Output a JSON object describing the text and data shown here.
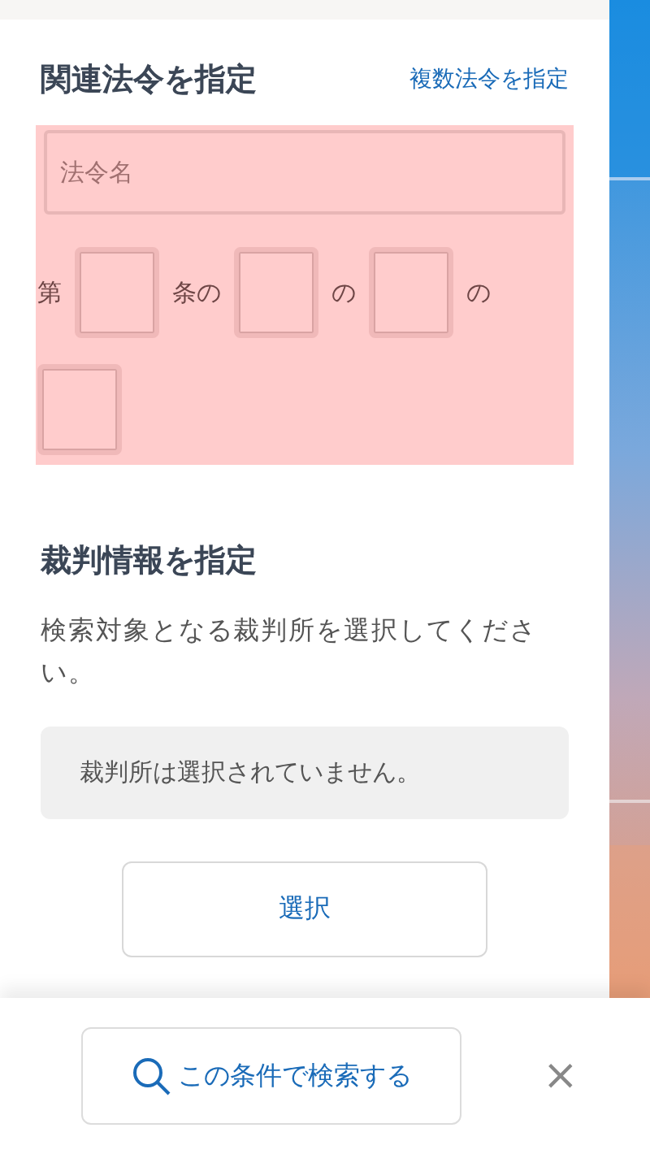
{
  "law_section": {
    "title": "関連法令を指定",
    "link": "複数法令を指定",
    "highlighted": true,
    "law_name": {
      "placeholder": "法令名"
    },
    "article_parts": [
      {
        "label": "第"
      },
      {
        "label": "条の"
      },
      {
        "label": "の"
      },
      {
        "label": "の"
      }
    ]
  },
  "court_section": {
    "title": "裁判情報を指定",
    "description": "検索対象となる裁判所を選択してください。",
    "selection_status": "裁判所は選択されていません。",
    "select_button": "選択"
  },
  "footer": {
    "search_button": "この条件で検索する",
    "close": "×"
  }
}
